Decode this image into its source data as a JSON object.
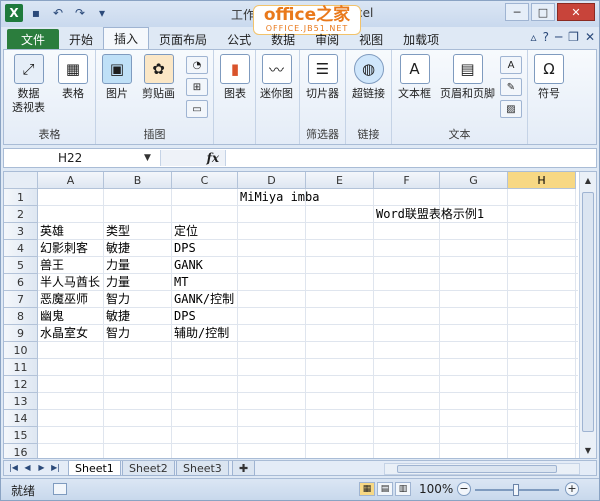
{
  "titlebar": {
    "title_left": "工作",
    "title_right": "cel",
    "watermark_main": "office之家",
    "watermark_sub": "OFFICE.JB51.NET"
  },
  "tabs": [
    "文件",
    "开始",
    "插入",
    "页面布局",
    "公式",
    "数据",
    "审阅",
    "视图",
    "加载项"
  ],
  "active_tab": "插入",
  "ribbon": {
    "groups": {
      "tables": "表格",
      "illustrations": "插图",
      "filter": "筛选器",
      "links": "链接",
      "text": "文本"
    },
    "buttons": {
      "pivot": "数据\n透视表",
      "table": "表格",
      "picture": "图片",
      "clipart": "剪贴画",
      "chart": "图表",
      "sparkline": "迷你图",
      "slicer": "切片器",
      "hyperlink": "超链接",
      "textbox": "文本框",
      "header_footer": "页眉和页脚",
      "symbol": "符号"
    }
  },
  "formula_bar": {
    "name_box": "H22",
    "fx": "fx",
    "formula": ""
  },
  "columns": [
    "A",
    "B",
    "C",
    "D",
    "E",
    "F",
    "G",
    "H"
  ],
  "selected_column": "H",
  "rows": [
    "1",
    "2",
    "3",
    "4",
    "5",
    "6",
    "7",
    "8",
    "9",
    "10",
    "11",
    "12",
    "13",
    "14",
    "15",
    "16"
  ],
  "cells": {
    "D1": "MiMiya imba",
    "F2": "Word联盟表格示例1",
    "A3": "英雄",
    "B3": "类型",
    "C3": "定位",
    "A4": "幻影刺客",
    "B4": "敏捷",
    "C4": "DPS",
    "A5": "兽王",
    "B5": "力量",
    "C5": "GANK",
    "A6": "半人马酋长",
    "B6": "力量",
    "C6": "MT",
    "A7": "恶魔巫师",
    "B7": "智力",
    "C7": "GANK/控制",
    "A8": "幽鬼",
    "B8": "敏捷",
    "C8": "DPS",
    "A9": "水晶室女",
    "B9": "智力",
    "C9": "辅助/控制"
  },
  "sheets": [
    "Sheet1",
    "Sheet2",
    "Sheet3"
  ],
  "active_sheet": "Sheet1",
  "status": {
    "ready": "就绪",
    "zoom": "100%"
  }
}
